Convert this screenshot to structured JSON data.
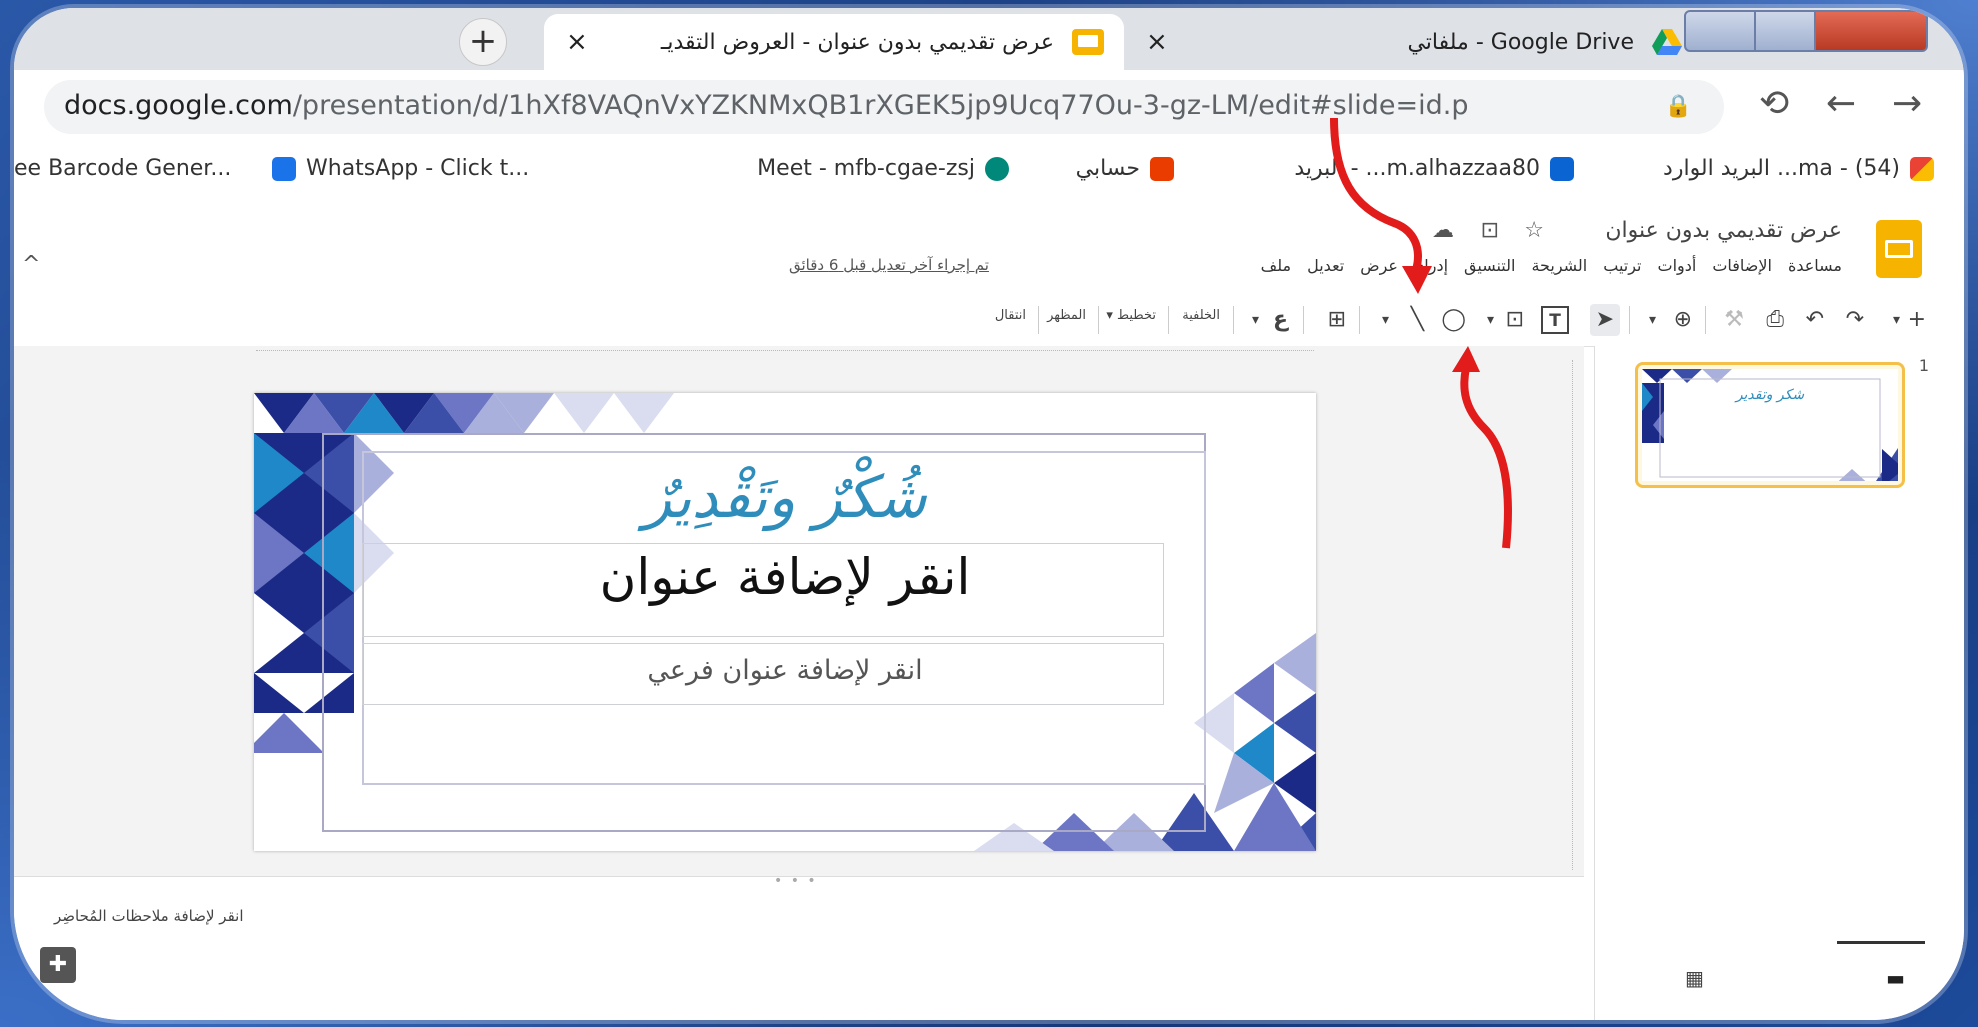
{
  "browser": {
    "new_tab_symbol": "+",
    "tabs": [
      {
        "title": "عرض تقديمي بدون عنوان - العروض التقديـ",
        "close": "×",
        "icon": "slides-icon",
        "active": true
      },
      {
        "title": "Google Drive - ملفاتي",
        "close": "×",
        "icon": "drive-icon",
        "active": false
      }
    ],
    "url_host": "docs.google.com",
    "url_path": "/presentation/d/1hXf8VAQnVxYZKNMxQB1rXGEK5jp9Ucq77Ou-3-gz-LM/edit#slide=id.p",
    "lock_icon": "🔒",
    "reload_symbol": "⟲",
    "back_symbol": "←",
    "forward_symbol": "→",
    "bookmarks": [
      {
        "label": "البريد الوارد ...ma - (54)",
        "icon": "gmail-icon",
        "color": "#ea4335"
      },
      {
        "label": "البريد - ...m.alhazzaa80",
        "icon": "outlook-icon",
        "color": "#0a64d2"
      },
      {
        "label": "حسابي",
        "icon": "office-icon",
        "color": "#eb3c00"
      },
      {
        "label": "Meet - mfb-cgae-zsj",
        "icon": "meet-icon",
        "color": "#00897b"
      },
      {
        "label": "WhatsApp - Click t...",
        "icon": "whatsapp-link-icon",
        "color": "#1a73e8"
      },
      {
        "label": "ee Barcode Gener...",
        "icon": "",
        "color": ""
      }
    ]
  },
  "app": {
    "doc_title": "عرض تقديمي بدون عنوان",
    "menus": [
      "ملف",
      "تعديل",
      "عرض",
      "إدراج",
      "التنسيق",
      "الشريحة",
      "ترتيب",
      "أدوات",
      "الإضافات",
      "مساعدة"
    ],
    "last_edit": "تم إجراء آخر تعديل قبل 6 دقائق",
    "toolbar_text": {
      "transition": "انتقال",
      "theme": "المظهر",
      "layout": "تخطيط ▾",
      "background": "الخلفية"
    },
    "accent": "#f6b400"
  },
  "slide": {
    "calligraphy": "شُكْرٌ وتَقْدِيرٌ",
    "title_placeholder": "انقر لإضافة عنوان",
    "subtitle_placeholder": "انقر لإضافة عنوان فرعي",
    "colors": [
      "#1b2a86",
      "#3c4fa8",
      "#6c76c4",
      "#aab0dc",
      "#dadcf0",
      "#1e88c8"
    ]
  },
  "notes": {
    "placeholder": "انقر لإضافة ملاحظات المُحاضِر",
    "button_symbol": "✚"
  },
  "filmstrip": {
    "slide_number": "1",
    "thumb_text": "شكر وتقدير",
    "grid_symbol": "▦",
    "list_symbol": "▬"
  }
}
